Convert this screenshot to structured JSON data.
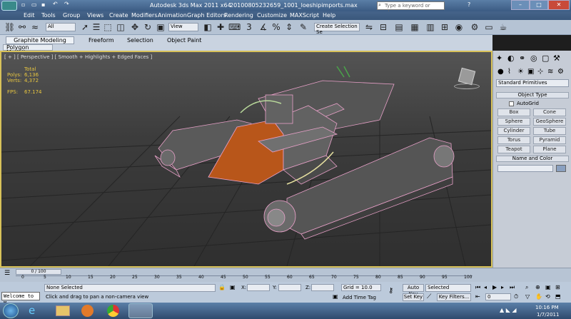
{
  "window": {
    "title": "Autodesk 3ds Max  2011 x64",
    "filename": "20100805232659_1001_loeshipimports.max",
    "search_placeholder": "Type a keyword or phrase"
  },
  "menu": [
    "Edit",
    "Tools",
    "Group",
    "Views",
    "Create",
    "Modifiers",
    "Animation",
    "Graph Editors",
    "Rendering",
    "Customize",
    "MAXScript",
    "Help"
  ],
  "toolbar": {
    "selection_filter": "All",
    "view_dropdown": "View",
    "selection_set": "Create Selection Se"
  },
  "ribbon": {
    "tabs": [
      "Graphite Modeling Tools",
      "Freeform",
      "Selection",
      "Object Paint"
    ],
    "subtab": "Polygon Modeling"
  },
  "viewport": {
    "label": "[ + ] [ Perspective ] [ Smooth + Highlights + Edged Faces ]",
    "stats": {
      "total_label": "Total",
      "polys_label": "Polys:",
      "polys_value": "6,136",
      "verts_label": "Verts:",
      "verts_value": "4,372",
      "fps_label": "FPS:",
      "fps_value": "67.174"
    }
  },
  "command_panel": {
    "primitive_dropdown": "Standard Primitives",
    "object_type_header": "Object Type",
    "autogrid_label": "AutoGrid",
    "buttons": [
      "Box",
      "Cone",
      "Sphere",
      "GeoSphere",
      "Cylinder",
      "Tube",
      "Torus",
      "Pyramid",
      "Teapot",
      "Plane"
    ],
    "name_color_header": "Name and Color"
  },
  "timeline": {
    "frame_display": "0 / 100",
    "ticks": [
      "0",
      "5",
      "10",
      "15",
      "20",
      "25",
      "30",
      "35",
      "40",
      "45",
      "50",
      "55",
      "60",
      "65",
      "70",
      "75",
      "80",
      "85",
      "90",
      "95",
      "100"
    ]
  },
  "status": {
    "listener": "Welcome to M",
    "selection": "None Selected",
    "prompt": "Click and drag to pan a non-camera view",
    "x_label": "X:",
    "y_label": "Y:",
    "z_label": "Z:",
    "grid": "Grid = 10.0",
    "add_time_tag": "Add Time Tag",
    "auto_key": "Auto Key",
    "auto_key_value": "Selected",
    "set_key": "Set Key",
    "key_filters": "Key Filters...",
    "frame": "0"
  },
  "taskbar": {
    "time": "10:16 PM",
    "date": "1/7/2011"
  },
  "colors": {
    "viewport_border": "#d8c25a",
    "wire_pink": "#e8a0c8",
    "cockpit_orange": "#b8561a"
  }
}
